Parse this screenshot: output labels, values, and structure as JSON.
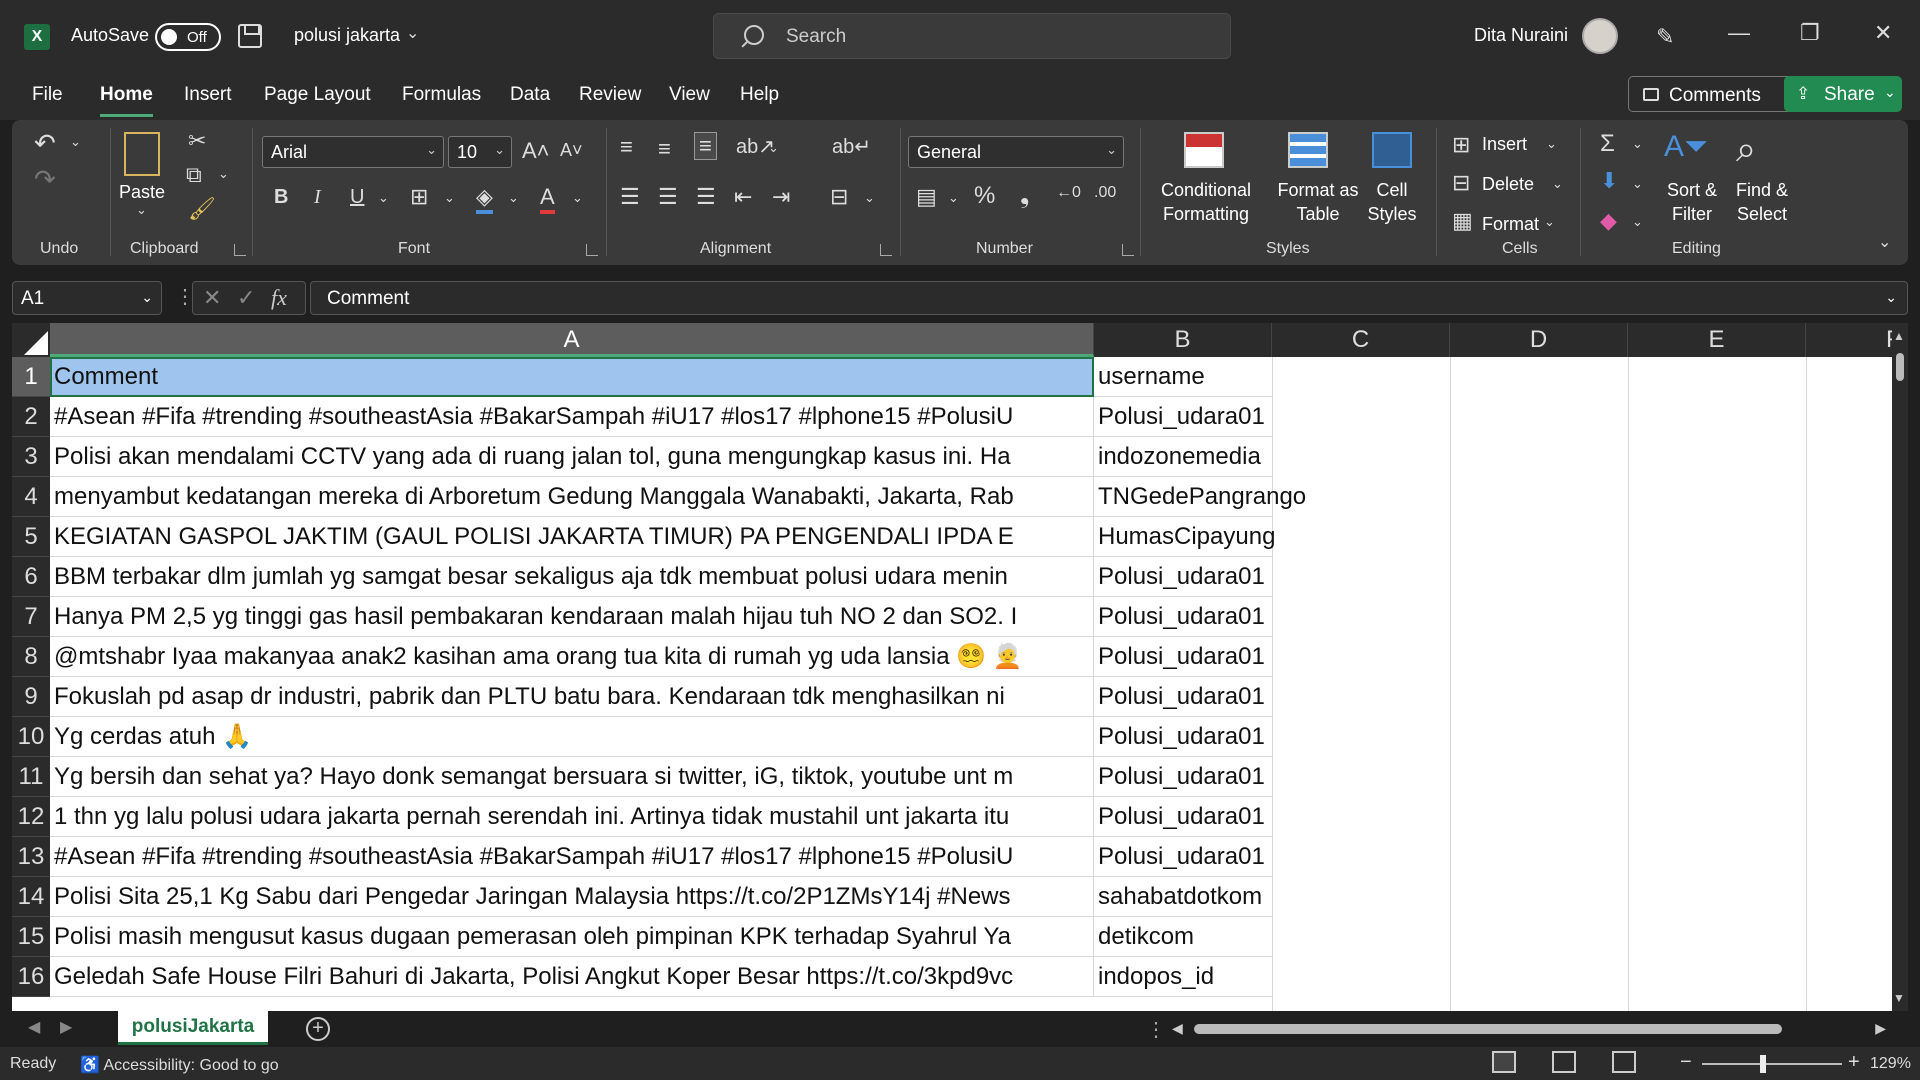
{
  "titlebar": {
    "app_icon": "excel-icon",
    "autosave_label": "AutoSave",
    "autosave_state": "Off",
    "file_name": "polusi jakarta",
    "search_placeholder": "Search",
    "user_name": "Dita Nuraini"
  },
  "tabs": {
    "items": [
      "File",
      "Home",
      "Insert",
      "Page Layout",
      "Formulas",
      "Data",
      "Review",
      "View",
      "Help"
    ],
    "active": "Home",
    "comments_label": "Comments",
    "share_label": "Share"
  },
  "ribbon": {
    "undo_group": "Undo",
    "clipboard_group": "Clipboard",
    "paste_label": "Paste",
    "font_group": "Font",
    "font_name": "Arial",
    "font_size": "10",
    "alignment_group": "Alignment",
    "number_group": "Number",
    "number_format": "General",
    "styles_group": "Styles",
    "conditional_formatting": [
      "Conditional",
      "Formatting"
    ],
    "format_as_table": [
      "Format as",
      "Table"
    ],
    "cell_styles": [
      "Cell",
      "Styles"
    ],
    "cells_group": "Cells",
    "insert_label": "Insert",
    "delete_label": "Delete",
    "format_label": "Format",
    "editing_group": "Editing",
    "sort_filter": [
      "Sort &",
      "Filter"
    ],
    "find_select": [
      "Find &",
      "Select"
    ]
  },
  "formula_bar": {
    "name_box": "A1",
    "formula": "Comment"
  },
  "grid": {
    "columns": [
      "A",
      "B",
      "C",
      "D",
      "E",
      "F"
    ],
    "rows": [
      {
        "n": "1",
        "a": "Comment",
        "b": "username"
      },
      {
        "n": "2",
        "a": "#Asean #Fifa #trending #southeastAsia #BakarSampah #iU17 #los17 #lphone15  #PolusiU",
        "b": "Polusi_udara01"
      },
      {
        "n": "3",
        "a": "Polisi akan mendalami CCTV yang ada di ruang jalan tol, guna mengungkap kasus ini. Ha",
        "b": "indozonemedia"
      },
      {
        "n": "4",
        "a": "menyambut kedatangan mereka di Arboretum Gedung Manggala Wanabakti, Jakarta, Rab",
        "b": "TNGedePangrango"
      },
      {
        "n": "5",
        "a": "KEGIATAN GASPOL JAKTIM (GAUL POLISI JAKARTA TIMUR) PA PENGENDALI IPDA E",
        "b": "HumasCipayung"
      },
      {
        "n": "6",
        "a": "BBM terbakar dlm jumlah yg samgat besar sekaligus aja tdk membuat polusi udara menin",
        "b": "Polusi_udara01"
      },
      {
        "n": "7",
        "a": "Hanya PM 2,5 yg tinggi gas hasil pembakaran kendaraan malah hijau tuh NO 2 dan SO2. I",
        "b": "Polusi_udara01"
      },
      {
        "n": "8",
        "a": "@mtshabr Iyaa makanyaa anak2 kasihan ama orang tua kita di rumah yg uda lansia 😵‍💫 🧑‍🦳",
        "b": "Polusi_udara01"
      },
      {
        "n": "9",
        "a": "Fokuslah pd asap dr industri, pabrik dan PLTU batu bara. Kendaraan tdk menghasilkan ni",
        "b": "Polusi_udara01"
      },
      {
        "n": "10",
        "a": "Yg cerdas atuh 🙏",
        "b": "Polusi_udara01"
      },
      {
        "n": "11",
        "a": "Yg bersih dan sehat ya? Hayo donk semangat bersuara si twitter, iG, tiktok, youtube unt m",
        "b": "Polusi_udara01"
      },
      {
        "n": "12",
        "a": "1 thn yg lalu polusi udara jakarta pernah serendah ini. Artinya tidak mustahil unt jakarta itu",
        "b": "Polusi_udara01"
      },
      {
        "n": "13",
        "a": "#Asean #Fifa #trending #southeastAsia #BakarSampah #iU17 #los17 #lphone15 #PolusiU",
        "b": "Polusi_udara01"
      },
      {
        "n": "14",
        "a": "Polisi Sita 25,1 Kg Sabu dari Pengedar Jaringan Malaysia  https://t.co/2P1ZMsY14j  #News",
        "b": "sahabatdotkom"
      },
      {
        "n": "15",
        "a": "Polisi masih mengusut kasus dugaan pemerasan oleh pimpinan KPK terhadap Syahrul Ya",
        "b": "detikcom"
      },
      {
        "n": "16",
        "a": "Geledah Safe House Filri Bahuri di Jakarta, Polisi Angkut Koper Besar https://t.co/3kpd9vc",
        "b": "indopos_id"
      }
    ]
  },
  "sheets": {
    "active": "polusiJakarta"
  },
  "statusbar": {
    "ready": "Ready",
    "accessibility": "Accessibility: Good to go",
    "zoom": "129%"
  },
  "colors": {
    "accent_green": "#217346",
    "selection_blue": "#9fc4ee",
    "share_green": "#218b52"
  }
}
